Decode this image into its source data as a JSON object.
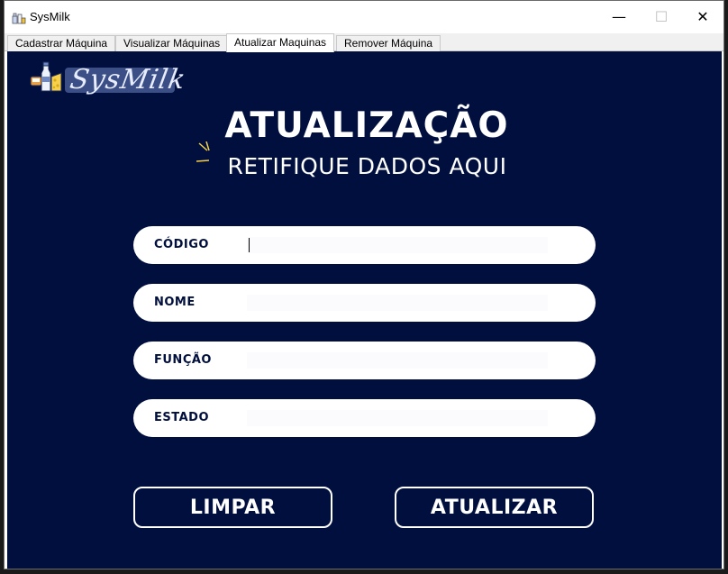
{
  "window": {
    "title": "SysMilk",
    "controls": {
      "minimize": "—",
      "maximize": "☐",
      "close": "✕"
    }
  },
  "tabs": [
    {
      "label": "Cadastrar Máquina"
    },
    {
      "label": "Visualizar Máquinas"
    },
    {
      "label": "Atualizar Maquinas",
      "active": true
    },
    {
      "label": "Remover Máquina"
    }
  ],
  "logo": {
    "text": "SysMilk"
  },
  "header": {
    "title": "ATUALIZAÇÃO",
    "subtitle": "RETIFIQUE DADOS AQUI"
  },
  "form": {
    "fields": [
      {
        "label": "CÓDIGO",
        "value": ""
      },
      {
        "label": "NOME",
        "value": ""
      },
      {
        "label": "FUNÇÃO",
        "value": ""
      },
      {
        "label": "ESTADO",
        "value": ""
      }
    ]
  },
  "actions": {
    "clear_label": "LIMPAR",
    "update_label": "ATUALIZAR"
  },
  "colors": {
    "background": "#000f3d",
    "accent": "#3b4f86",
    "field": "#ffffff",
    "text_on_dark": "#ffffff"
  },
  "icons": {
    "app": "milk-bottle-icon",
    "logo": "dairy-products-icon",
    "decoration": "sparkle-icon"
  }
}
